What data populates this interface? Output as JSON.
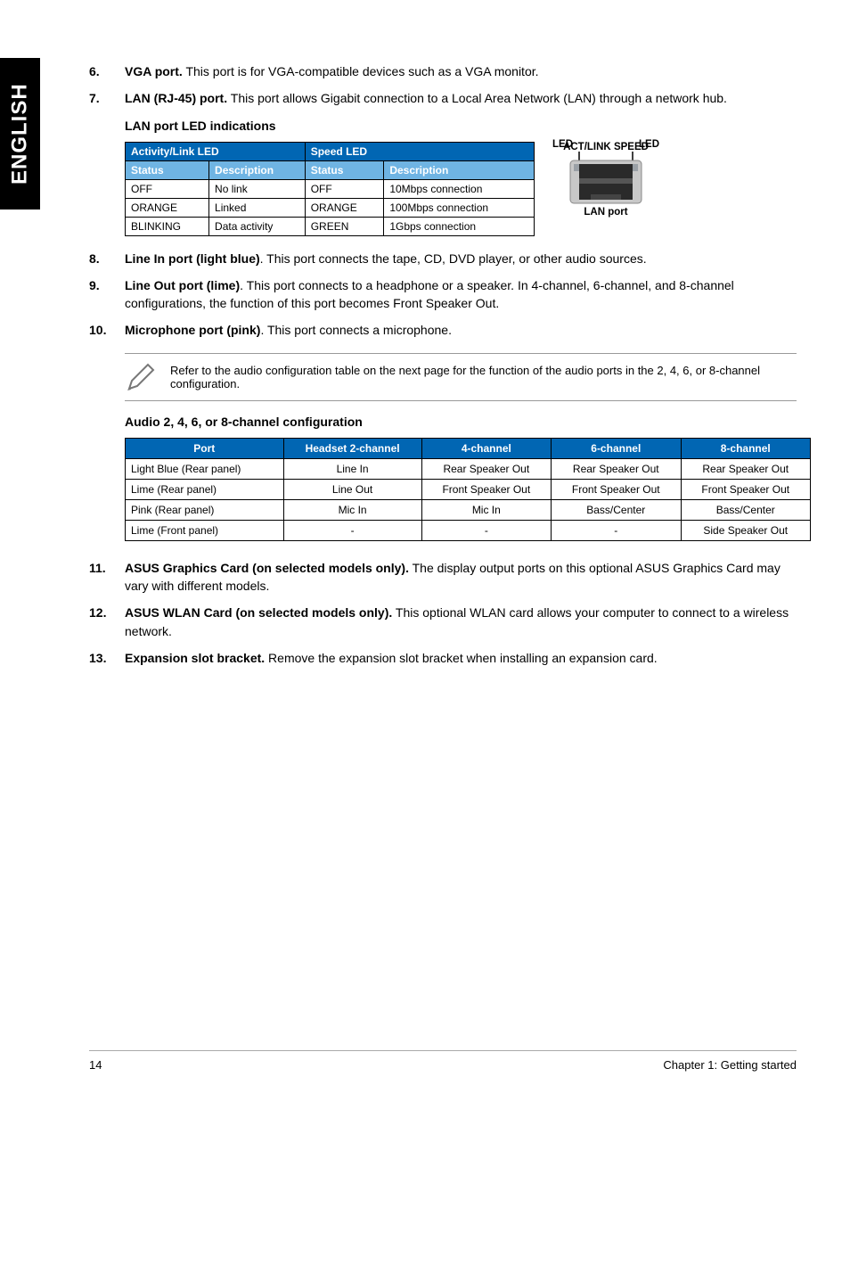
{
  "side_tab": "ENGLISH",
  "items": [
    {
      "num": "6.",
      "title": "VGA port.",
      "text": " This port is for VGA-compatible devices such as a VGA monitor."
    },
    {
      "num": "7.",
      "title": "LAN (RJ-45) port.",
      "text": " This port allows Gigabit connection to a Local Area Network (LAN) through a network hub."
    }
  ],
  "lan_heading": "LAN port LED indications",
  "lan_diagram": {
    "top1": "ACT/LINK",
    "top2": "SPEED",
    "led_left": "LED",
    "led_right": "LED",
    "caption": "LAN port"
  },
  "lan_table": {
    "group_activity": "Activity/Link LED",
    "group_speed": "Speed LED",
    "col_status": "Status",
    "col_desc": "Description",
    "rows": [
      {
        "s1": "OFF",
        "d1": "No link",
        "s2": "OFF",
        "d2": "10Mbps connection"
      },
      {
        "s1": "ORANGE",
        "d1": "Linked",
        "s2": "ORANGE",
        "d2": "100Mbps connection"
      },
      {
        "s1": "BLINKING",
        "d1": "Data activity",
        "s2": "GREEN",
        "d2": "1Gbps connection"
      }
    ]
  },
  "items2": [
    {
      "num": "8.",
      "title": "Line In port (light blue)",
      "text": ". This port connects the tape, CD, DVD player, or other audio sources."
    },
    {
      "num": "9.",
      "title": "Line Out port (lime)",
      "text": ". This port connects to a headphone or a speaker. In 4-channel, 6-channel, and 8-channel configurations, the function of this port becomes Front Speaker Out."
    },
    {
      "num": "10.",
      "title": "Microphone port (pink)",
      "text": ". This port connects a microphone."
    }
  ],
  "note": "Refer to the audio configuration table on the next page for the function of the audio ports in the 2, 4, 6, or 8-channel configuration.",
  "audio_title": "Audio 2, 4, 6, or 8-channel configuration",
  "audio_table": {
    "headers": [
      "Port",
      "Headset 2-channel",
      "4-channel",
      "6-channel",
      "8-channel"
    ],
    "rows": [
      [
        "Light Blue (Rear panel)",
        "Line In",
        "Rear Speaker Out",
        "Rear Speaker Out",
        "Rear Speaker Out"
      ],
      [
        "Lime (Rear panel)",
        "Line Out",
        "Front Speaker Out",
        "Front Speaker Out",
        "Front Speaker Out"
      ],
      [
        "Pink (Rear panel)",
        "Mic In",
        "Mic In",
        "Bass/Center",
        "Bass/Center"
      ],
      [
        "Lime (Front panel)",
        "-",
        "-",
        "-",
        "Side Speaker Out"
      ]
    ]
  },
  "items3": [
    {
      "num": "11.",
      "title": "ASUS Graphics Card (on selected models only).",
      "text": " The display output ports on this optional ASUS Graphics Card may vary with different models."
    },
    {
      "num": "12.",
      "title": "ASUS WLAN Card (on selected models only).",
      "text": " This optional WLAN card allows your computer to connect to a wireless network."
    },
    {
      "num": "13.",
      "title": "Expansion slot bracket.",
      "text": " Remove the expansion slot bracket when installing an expansion card."
    }
  ],
  "footer": {
    "page": "14",
    "chapter": "Chapter 1: Getting started"
  }
}
